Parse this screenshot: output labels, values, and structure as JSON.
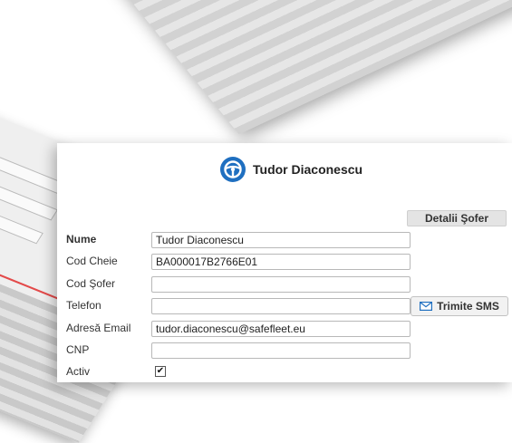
{
  "driver": {
    "name": "Tudor Diaconescu"
  },
  "section": {
    "title": "Detalii Şofer"
  },
  "form": {
    "fields": [
      {
        "label": "Nume",
        "value": "Tudor Diaconescu"
      },
      {
        "label": "Cod Cheie",
        "value": "BA000017B2766E01"
      },
      {
        "label": "Cod Şofer",
        "value": ""
      },
      {
        "label": "Telefon",
        "value": ""
      },
      {
        "label": "Adresă Email",
        "value": "tudor.diaconescu@safefleet.eu"
      },
      {
        "label": "CNP",
        "value": ""
      }
    ],
    "active_label": "Activ",
    "active_checked": true
  },
  "actions": {
    "sms_label": "Trimite SMS"
  },
  "colors": {
    "brand_blue": "#1f6fc0",
    "tab_bg": "#e4e4e4"
  },
  "icons": {
    "header": "steering-wheel-icon",
    "sms": "envelope-icon"
  }
}
